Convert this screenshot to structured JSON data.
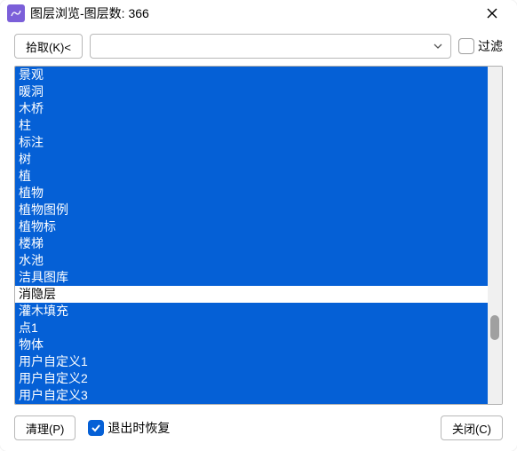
{
  "window": {
    "title": "图层浏览-图层数: 366"
  },
  "toolbar": {
    "pick_label": "拾取(K)<",
    "combo_value": "",
    "filter_label": "过滤",
    "filter_checked": false
  },
  "list": {
    "items": [
      {
        "label": "景观",
        "selected": true
      },
      {
        "label": "暖洞",
        "selected": true
      },
      {
        "label": "木桥",
        "selected": true
      },
      {
        "label": "柱",
        "selected": true
      },
      {
        "label": "标注",
        "selected": true
      },
      {
        "label": "树",
        "selected": true
      },
      {
        "label": "植",
        "selected": true
      },
      {
        "label": "植物",
        "selected": true
      },
      {
        "label": "植物图例",
        "selected": true
      },
      {
        "label": "植物标",
        "selected": true
      },
      {
        "label": "楼梯",
        "selected": true
      },
      {
        "label": "水池",
        "selected": true
      },
      {
        "label": "洁具图库",
        "selected": true
      },
      {
        "label": "消隐层",
        "selected": false
      },
      {
        "label": "灌木填充",
        "selected": true
      },
      {
        "label": "点1",
        "selected": true
      },
      {
        "label": "物体",
        "selected": true
      },
      {
        "label": "用户自定义1",
        "selected": true
      },
      {
        "label": "用户自定义2",
        "selected": true
      },
      {
        "label": "用户自定义3",
        "selected": true
      }
    ]
  },
  "footer": {
    "cleanup_label": "清理(P)",
    "restore_label": "退出时恢复",
    "restore_checked": true,
    "close_label": "关闭(C)"
  }
}
